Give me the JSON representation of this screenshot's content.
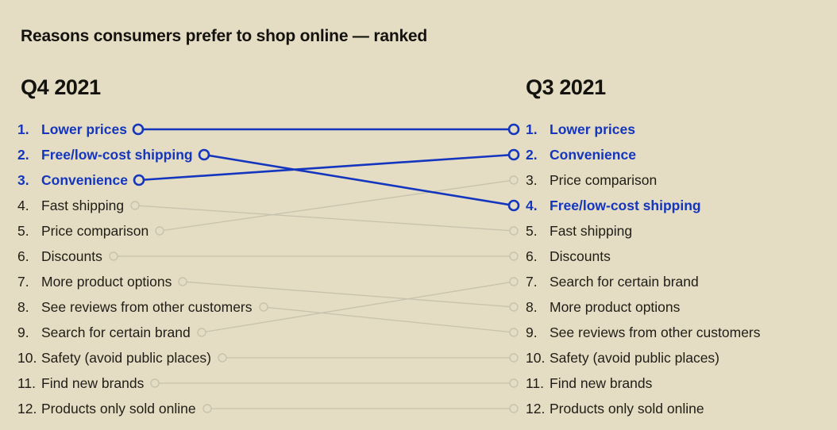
{
  "title": "Reasons consumers prefer to shop online — ranked",
  "colors": {
    "background": "#e4ddc3",
    "text": "#201c16",
    "highlight": "#1435bd",
    "link_highlight": "#1435bd",
    "link_muted": "#c7c2ad"
  },
  "columns": {
    "left": {
      "header": "Q4 2021"
    },
    "right": {
      "header": "Q3 2021"
    }
  },
  "chart_data": {
    "type": "slopegraph",
    "title": "Reasons consumers prefer to shop online — ranked",
    "axis_labels": [
      "Q4 2021",
      "Q3 2021"
    ],
    "left_column_label": "Q4 2021",
    "right_column_label": "Q3 2021",
    "rank_scale": [
      1,
      12
    ],
    "grid": false,
    "legend_position": "none",
    "items": [
      {
        "label": "Lower prices",
        "left_rank": 1,
        "right_rank": 1,
        "highlight": true
      },
      {
        "label": "Free/low-cost shipping",
        "left_rank": 2,
        "right_rank": 4,
        "highlight": true
      },
      {
        "label": "Convenience",
        "left_rank": 3,
        "right_rank": 2,
        "highlight": true
      },
      {
        "label": "Fast shipping",
        "left_rank": 4,
        "right_rank": 5,
        "highlight": false
      },
      {
        "label": "Price comparison",
        "left_rank": 5,
        "right_rank": 3,
        "highlight": false
      },
      {
        "label": "Discounts",
        "left_rank": 6,
        "right_rank": 6,
        "highlight": false
      },
      {
        "label": "More product options",
        "left_rank": 7,
        "right_rank": 8,
        "highlight": false
      },
      {
        "label": "See reviews from other customers",
        "left_rank": 8,
        "right_rank": 9,
        "highlight": false
      },
      {
        "label": "Search for certain brand",
        "left_rank": 9,
        "right_rank": 7,
        "highlight": false
      },
      {
        "label": "Safety (avoid public places)",
        "left_rank": 10,
        "right_rank": 10,
        "highlight": false
      },
      {
        "label": "Find new brands",
        "left_rank": 11,
        "right_rank": 11,
        "highlight": false
      },
      {
        "label": "Products only sold online",
        "left_rank": 12,
        "right_rank": 12,
        "highlight": false
      }
    ]
  },
  "left_list": [
    {
      "num": "1.",
      "label": "Lower prices",
      "highlight": true
    },
    {
      "num": "2.",
      "label": "Free/low-cost shipping",
      "highlight": true
    },
    {
      "num": "3.",
      "label": "Convenience",
      "highlight": true
    },
    {
      "num": "4.",
      "label": "Fast shipping",
      "highlight": false
    },
    {
      "num": "5.",
      "label": "Price comparison",
      "highlight": false
    },
    {
      "num": "6.",
      "label": "Discounts",
      "highlight": false
    },
    {
      "num": "7.",
      "label": "More product options",
      "highlight": false
    },
    {
      "num": "8.",
      "label": "See reviews from other customers",
      "highlight": false
    },
    {
      "num": "9.",
      "label": "Search for certain brand",
      "highlight": false
    },
    {
      "num": "10.",
      "label": "Safety (avoid public places)",
      "highlight": false
    },
    {
      "num": "11.",
      "label": "Find new brands",
      "highlight": false
    },
    {
      "num": "12.",
      "label": "Products only sold online",
      "highlight": false
    }
  ],
  "right_list": [
    {
      "num": "1.",
      "label": "Lower prices",
      "highlight": true
    },
    {
      "num": "2.",
      "label": "Convenience",
      "highlight": true
    },
    {
      "num": "3.",
      "label": "Price comparison",
      "highlight": false
    },
    {
      "num": "4.",
      "label": "Free/low-cost shipping",
      "highlight": true
    },
    {
      "num": "5.",
      "label": "Fast shipping",
      "highlight": false
    },
    {
      "num": "6.",
      "label": "Discounts",
      "highlight": false
    },
    {
      "num": "7.",
      "label": "Search for certain brand",
      "highlight": false
    },
    {
      "num": "8.",
      "label": "More product options",
      "highlight": false
    },
    {
      "num": "9.",
      "label": "See reviews from other customers",
      "highlight": false
    },
    {
      "num": "10.",
      "label": "Safety (avoid public places)",
      "highlight": false
    },
    {
      "num": "11.",
      "label": "Find new brands",
      "highlight": false
    },
    {
      "num": "12.",
      "label": "Products only sold online",
      "highlight": false
    }
  ]
}
